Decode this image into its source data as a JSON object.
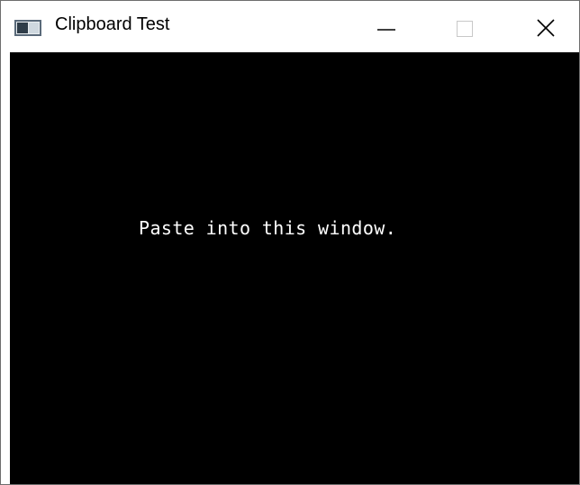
{
  "window": {
    "title": "Clipboard Test",
    "icon": "application-window-icon"
  },
  "controls": {
    "minimize_icon": "minimize-icon",
    "maximize_icon": "maximize-icon",
    "close_icon": "close-icon"
  },
  "content": {
    "message": "Paste into this window.",
    "background_color": "#000000",
    "text_color": "#ffffff"
  }
}
